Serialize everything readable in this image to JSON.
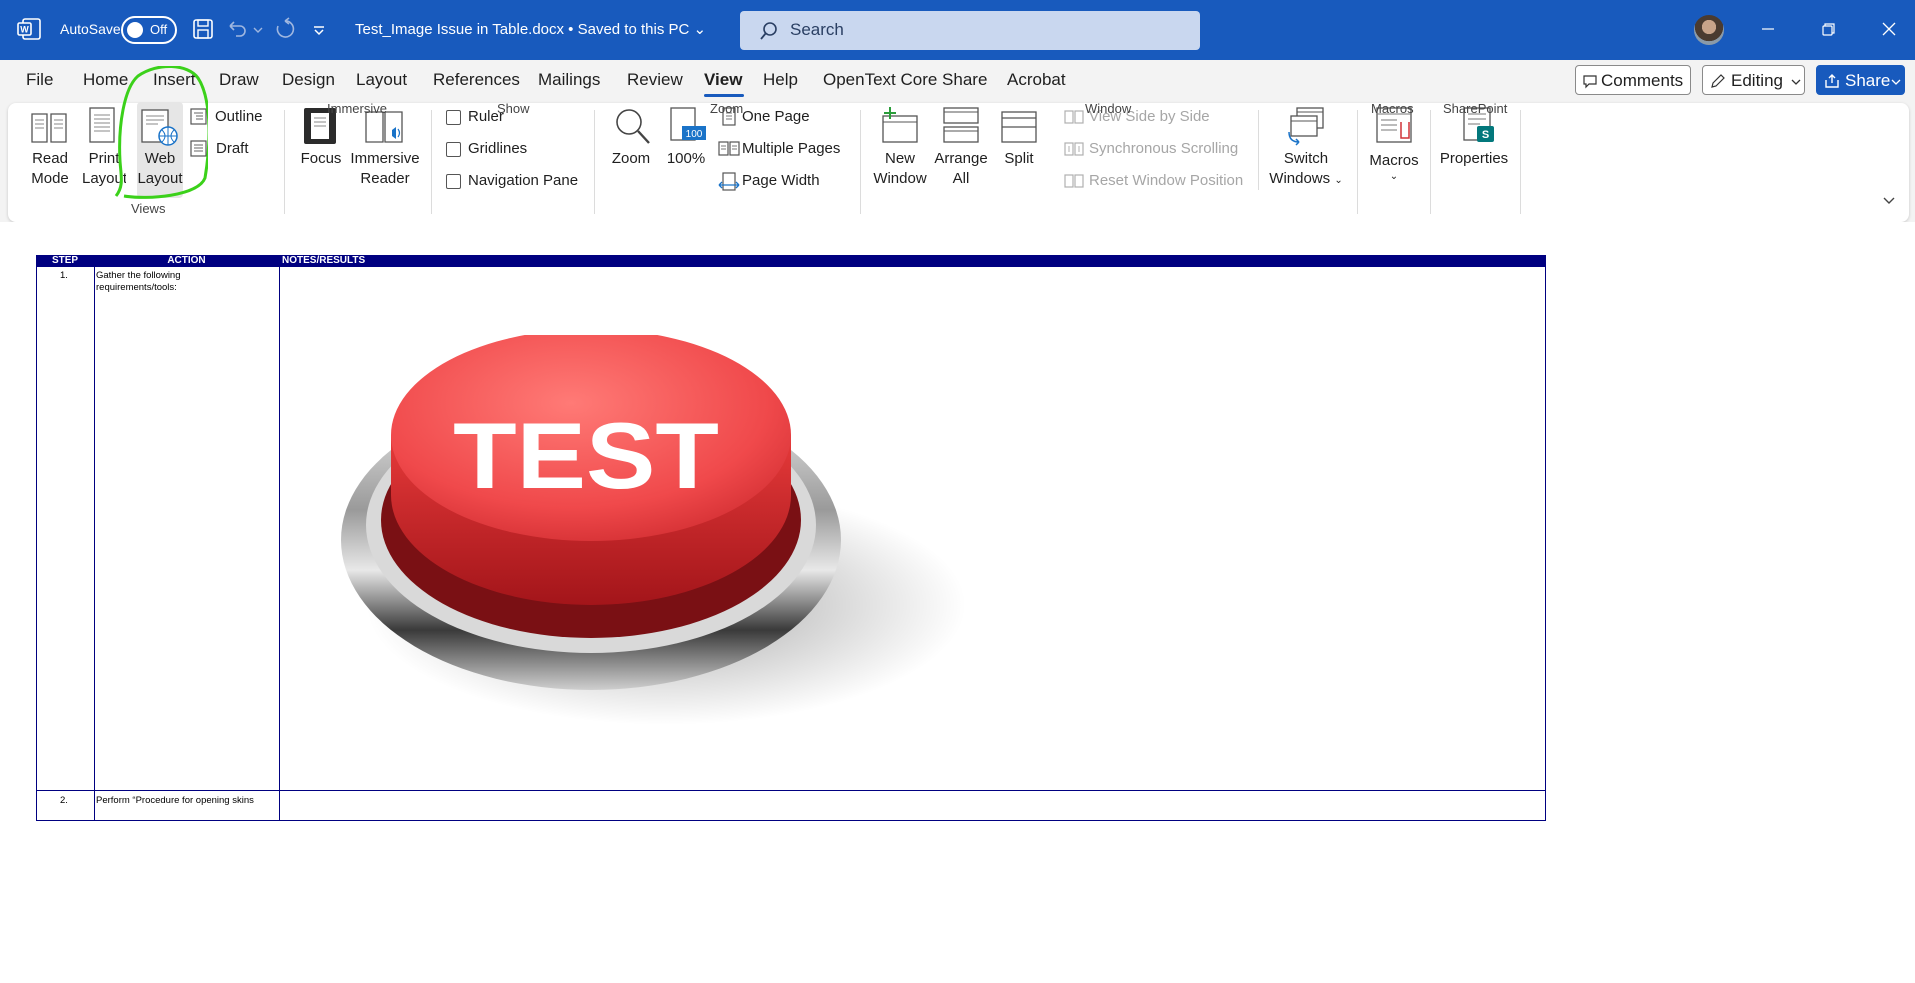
{
  "titlebar": {
    "autosave_label": "AutoSave",
    "autosave_state": "Off",
    "doc_title": "Test_Image Issue in Table.docx • Saved to this PC ⌄",
    "search_placeholder": "Search",
    "accent_color": "#185abd"
  },
  "tabs": [
    {
      "label": "File"
    },
    {
      "label": "Home"
    },
    {
      "label": "Insert"
    },
    {
      "label": "Draw"
    },
    {
      "label": "Design"
    },
    {
      "label": "Layout"
    },
    {
      "label": "References"
    },
    {
      "label": "Mailings"
    },
    {
      "label": "Review"
    },
    {
      "label": "View",
      "active": true
    },
    {
      "label": "Help"
    },
    {
      "label": "OpenText Core Share"
    },
    {
      "label": "Acrobat"
    }
  ],
  "right_buttons": {
    "comments": "Comments",
    "editing": "Editing",
    "share": "Share"
  },
  "ribbon": {
    "views": {
      "read_mode": [
        "Read",
        "Mode"
      ],
      "print_layout": [
        "Print",
        "Layout"
      ],
      "web_layout": [
        "Web",
        "Layout"
      ],
      "outline": "Outline",
      "draft": "Draft",
      "group": "Views"
    },
    "immersive": {
      "focus": "Focus",
      "reader": [
        "Immersive",
        "Reader"
      ],
      "group": "Immersive"
    },
    "show": {
      "ruler": "Ruler",
      "gridlines": "Gridlines",
      "navigation_pane": "Navigation Pane",
      "group": "Show"
    },
    "zoom": {
      "zoom": "Zoom",
      "hundred": "100%",
      "one_page": "One Page",
      "multiple_pages": "Multiple Pages",
      "page_width": "Page Width",
      "group": "Zoom"
    },
    "window": {
      "new_window": [
        "New",
        "Window"
      ],
      "arrange_all": [
        "Arrange",
        "All"
      ],
      "split": "Split",
      "view_side_by_side": "View Side by Side",
      "synchronous_scrolling": "Synchronous Scrolling",
      "reset_window_position": "Reset Window Position",
      "switch_windows": [
        "Switch",
        "Windows"
      ],
      "group": "Window"
    },
    "macros": {
      "macros": "Macros",
      "group": "Macros"
    },
    "sharepoint": {
      "properties": "Properties",
      "group": "SharePoint"
    }
  },
  "document": {
    "table_headers": [
      "STEP",
      "ACTION",
      "NOTES/RESULTS"
    ],
    "rows": [
      {
        "step": "1.",
        "action": [
          "Gather the following",
          "requirements/tools:"
        ]
      },
      {
        "step": "2.",
        "action": [
          "Perform “Procedure for opening skins"
        ]
      }
    ],
    "image_text": "TEST"
  }
}
